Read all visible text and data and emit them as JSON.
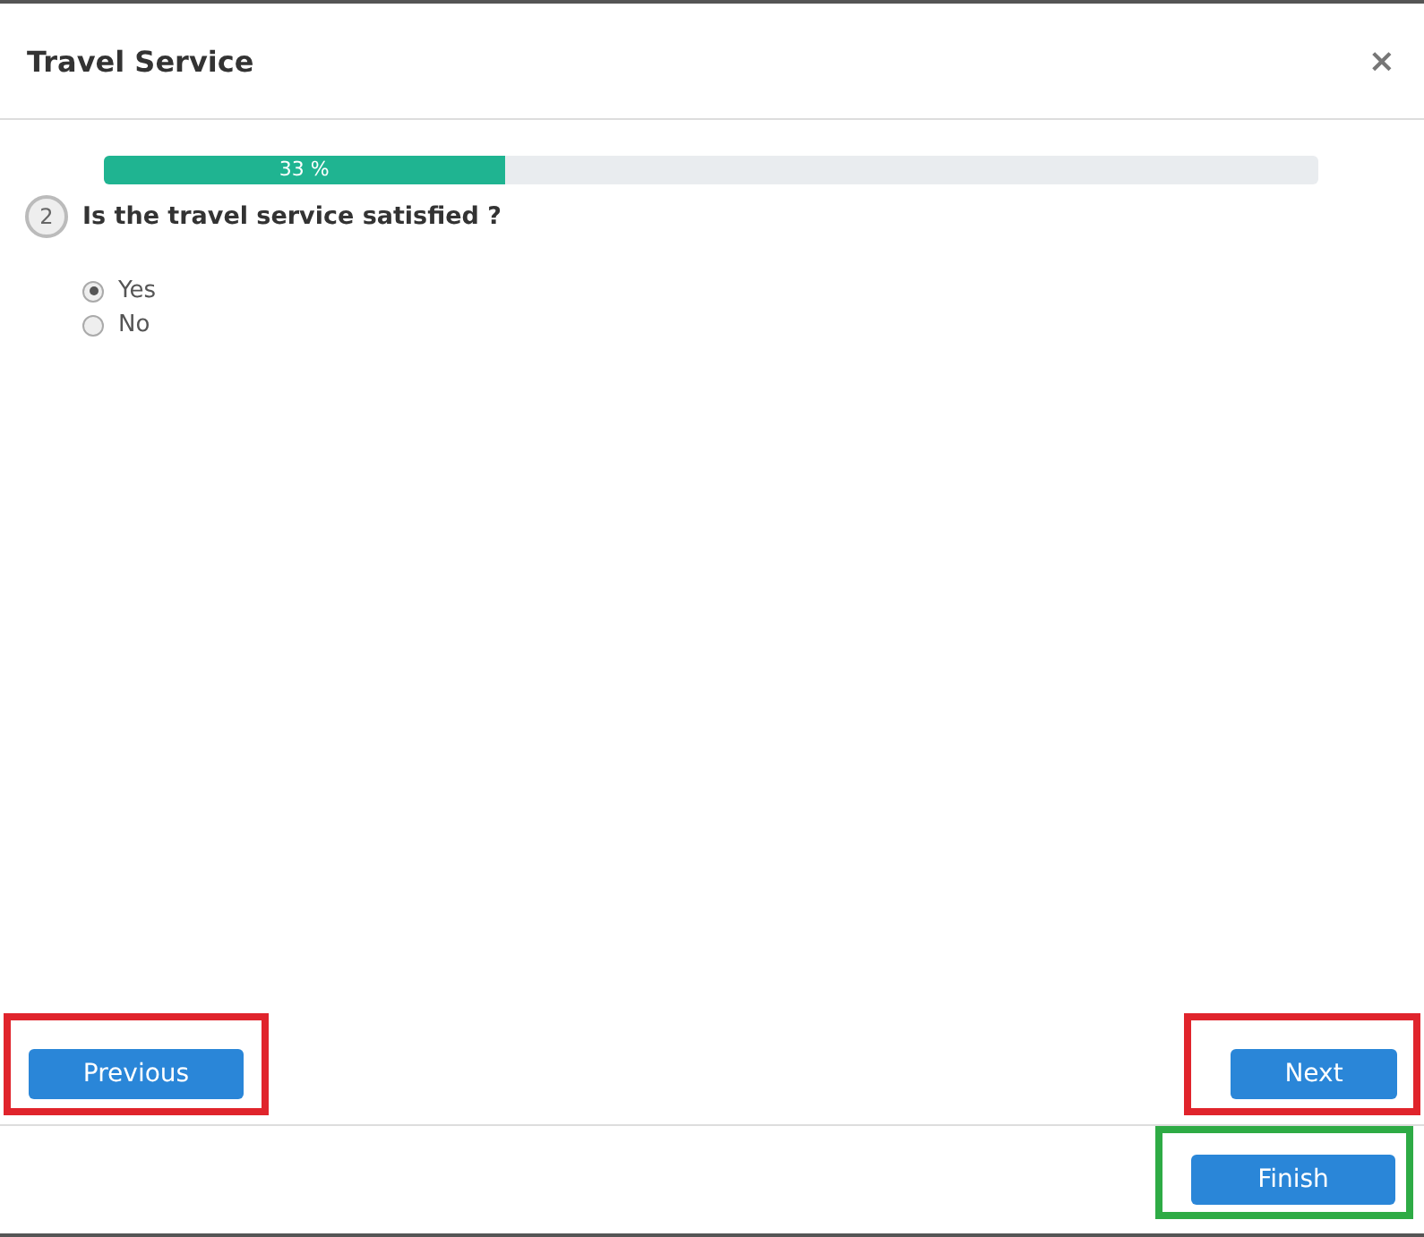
{
  "dialog": {
    "title": "Travel Service",
    "close": "×"
  },
  "progress": {
    "level": 0.33,
    "reading": "33 %"
  },
  "question": {
    "number": "2",
    "text": "Is the travel service satisfied ?",
    "options": [
      {
        "label": "Yes",
        "selected": true
      },
      {
        "label": "No",
        "selected": false
      }
    ]
  },
  "nav_buttons": [
    {
      "label": "Previous",
      "color": "#e0242c"
    },
    {
      "label": "Next",
      "color": "#e0242c"
    }
  ],
  "footer_buttons": [
    {
      "label": "Finish",
      "color": "#2eab45"
    }
  ]
}
